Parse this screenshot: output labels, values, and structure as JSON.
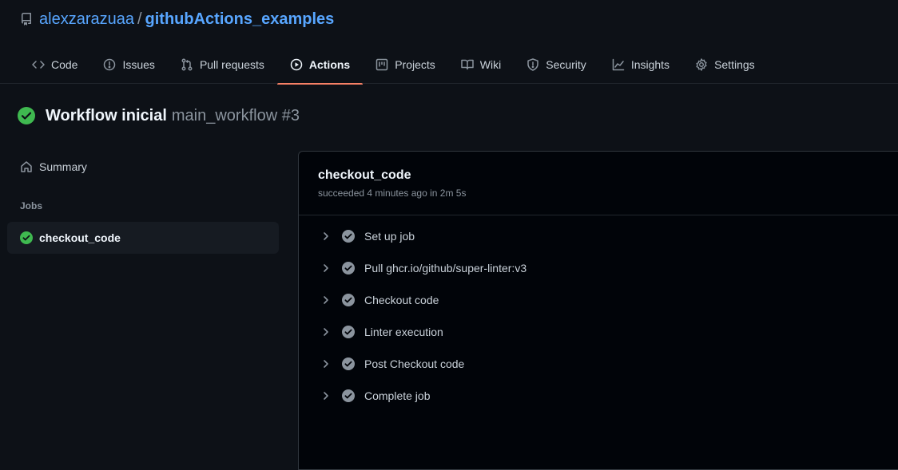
{
  "repo": {
    "owner": "alexzarazuaa",
    "separator": "/",
    "name": "githubActions_examples"
  },
  "tabs": [
    {
      "label": "Code",
      "icon": "code-icon",
      "active": false
    },
    {
      "label": "Issues",
      "icon": "issue-icon",
      "active": false
    },
    {
      "label": "Pull requests",
      "icon": "pull-request-icon",
      "active": false
    },
    {
      "label": "Actions",
      "icon": "play-icon",
      "active": true
    },
    {
      "label": "Projects",
      "icon": "project-icon",
      "active": false
    },
    {
      "label": "Wiki",
      "icon": "book-icon",
      "active": false
    },
    {
      "label": "Security",
      "icon": "shield-icon",
      "active": false
    },
    {
      "label": "Insights",
      "icon": "graph-icon",
      "active": false
    },
    {
      "label": "Settings",
      "icon": "gear-icon",
      "active": false
    }
  ],
  "workflow": {
    "title": "Workflow inicial",
    "meta": "main_workflow #3"
  },
  "sidebar": {
    "summary_label": "Summary",
    "jobs_heading": "Jobs",
    "jobs": [
      {
        "label": "checkout_code",
        "selected": true
      }
    ]
  },
  "job": {
    "name": "checkout_code",
    "status": "succeeded 4 minutes ago in 2m 5s",
    "steps": [
      {
        "label": "Set up job"
      },
      {
        "label": "Pull ghcr.io/github/super-linter:v3"
      },
      {
        "label": "Checkout code"
      },
      {
        "label": "Linter execution"
      },
      {
        "label": "Post Checkout code"
      },
      {
        "label": "Complete job"
      }
    ]
  },
  "colors": {
    "background": "#0d1117",
    "link": "#58a6ff",
    "success": "#3fb950",
    "active_tab_underline": "#f78166",
    "muted": "#8b949e"
  }
}
